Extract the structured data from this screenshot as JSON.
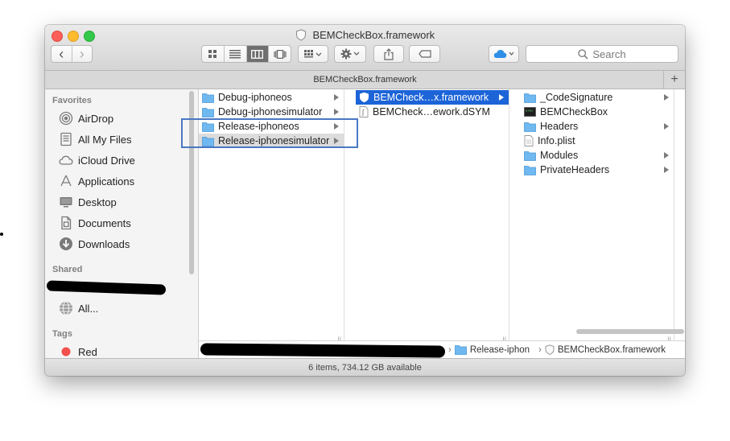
{
  "window": {
    "title": "BEMCheckBox.framework",
    "path_title": "BEMCheckBox.framework",
    "plus": "+"
  },
  "toolbar": {
    "back": "‹",
    "forward": "›",
    "search_placeholder": "Search"
  },
  "sidebar": {
    "favorites_header": "Favorites",
    "favorites": [
      "AirDrop",
      "All My Files",
      "iCloud Drive",
      "Applications",
      "Desktop",
      "Documents",
      "Downloads"
    ],
    "shared_header": "Shared",
    "shared_all": "All...",
    "tags_header": "Tags",
    "tag_red": "Red"
  },
  "columns": {
    "col1": [
      "Debug-iphoneos",
      "Debug-iphonesimulator",
      "Release-iphoneos",
      "Release-iphonesimulator"
    ],
    "col2": [
      "BEMCheck…x.framework",
      "BEMCheck…ework.dSYM"
    ],
    "col3": [
      "_CodeSignature",
      "BEMCheckBox",
      "Headers",
      "Info.plist",
      "Modules",
      "PrivateHeaders"
    ]
  },
  "pathbar": {
    "seg1": "Release-iphon",
    "seg2": "BEMCheckBox.framework"
  },
  "status": "6 items, 734.12 GB available",
  "colors": {
    "selection": "#1c64d8",
    "folder": "#6fb8f0",
    "highlight_border": "#4a78c4",
    "tag_red": "#f2504c"
  }
}
